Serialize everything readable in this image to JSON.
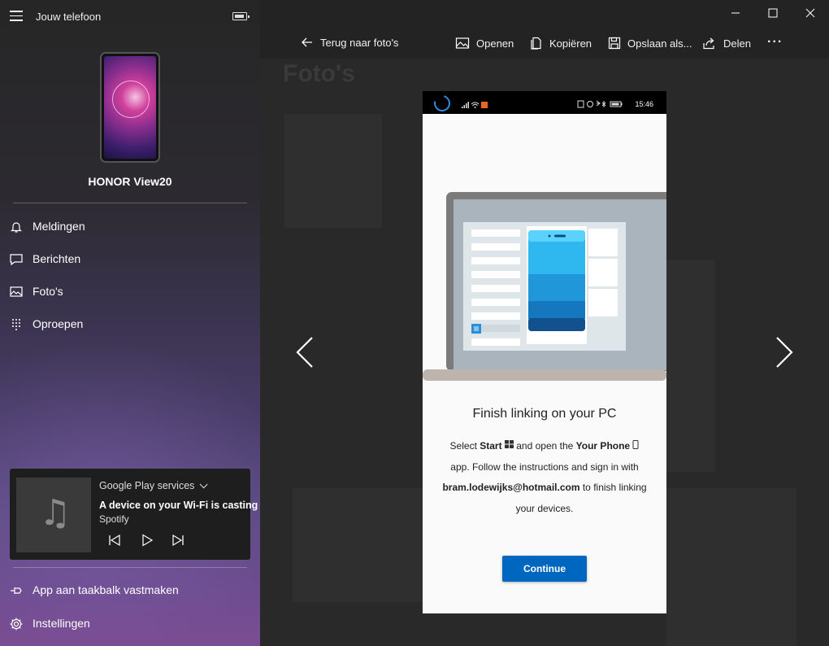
{
  "sidebar": {
    "app_title": "Jouw telefoon",
    "device_name": "HONOR View20",
    "nav": [
      {
        "label": "Meldingen",
        "icon": "bell-icon"
      },
      {
        "label": "Berichten",
        "icon": "message-icon"
      },
      {
        "label": "Foto's",
        "icon": "photos-icon"
      },
      {
        "label": "Oproepen",
        "icon": "dialpad-icon"
      }
    ],
    "media": {
      "source": "Google Play services",
      "title": "A device on your Wi-Fi is casting",
      "artist": "Spotify"
    },
    "bottom": [
      {
        "label": "App aan taakbalk vastmaken",
        "icon": "pin-icon"
      },
      {
        "label": "Instellingen",
        "icon": "gear-icon"
      }
    ]
  },
  "toolbar": {
    "back_label": "Terug naar foto's",
    "open_label": "Openen",
    "copy_label": "Kopiëren",
    "save_label": "Opslaan als...",
    "share_label": "Delen",
    "more_label": "..."
  },
  "background": {
    "ghost_title": "Foto's"
  },
  "screenshot": {
    "status_time": "15:46",
    "heading": "Finish linking on your PC",
    "body": {
      "p1": "Select ",
      "start": "Start",
      "p2": " and open the ",
      "your_phone": "Your Phone",
      "p3": " app. Follow the instructions and sign in with ",
      "email": "bram.lodewijks@hotmail.com",
      "p4": " to finish linking your devices."
    },
    "continue_label": "Continue"
  },
  "colors": {
    "accent": "#0067c0",
    "illustration_blue": "#2fb8ef"
  }
}
